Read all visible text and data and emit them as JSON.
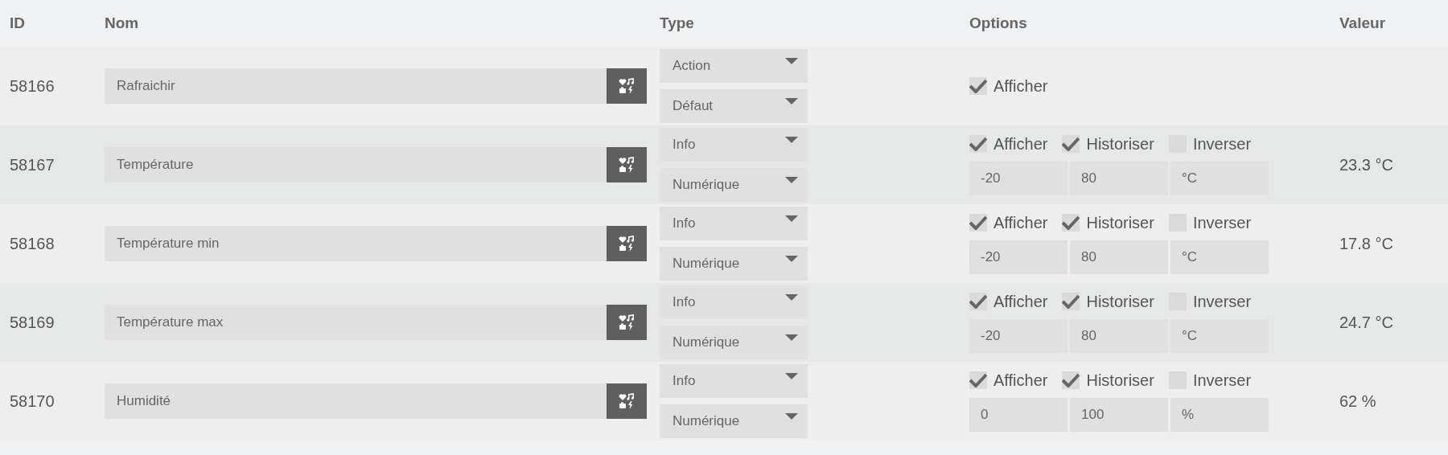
{
  "columns": [
    "ID",
    "Nom",
    "Type",
    "Options",
    "Valeur"
  ],
  "rows": [
    {
      "id": "58166",
      "name": "Rafraichir",
      "type": "Action",
      "subtype": "Défaut",
      "options": [
        {
          "label": "Afficher",
          "checked": true
        }
      ]
    },
    {
      "id": "58167",
      "name": "Température",
      "type": "Info",
      "subtype": "Numérique",
      "options": [
        {
          "label": "Afficher",
          "checked": true
        },
        {
          "label": "Historiser",
          "checked": true
        },
        {
          "label": "Inverser",
          "checked": false
        }
      ],
      "fields": [
        "-20",
        "80",
        "°C"
      ],
      "value": "23.3 °C"
    },
    {
      "id": "58168",
      "name": "Température min",
      "type": "Info",
      "subtype": "Numérique",
      "options": [
        {
          "label": "Afficher",
          "checked": true
        },
        {
          "label": "Historiser",
          "checked": true
        },
        {
          "label": "Inverser",
          "checked": false
        }
      ],
      "fields": [
        "-20",
        "80",
        "°C"
      ],
      "value": "17.8 °C"
    },
    {
      "id": "58169",
      "name": "Température max",
      "type": "Info",
      "subtype": "Numérique",
      "options": [
        {
          "label": "Afficher",
          "checked": true
        },
        {
          "label": "Historiser",
          "checked": true
        },
        {
          "label": "Inverser",
          "checked": false
        }
      ],
      "fields": [
        "-20",
        "80",
        "°C"
      ],
      "value": "24.7 °C"
    },
    {
      "id": "58170",
      "name": "Humidité",
      "type": "Info",
      "subtype": "Numérique",
      "options": [
        {
          "label": "Afficher",
          "checked": true
        },
        {
          "label": "Historiser",
          "checked": true
        },
        {
          "label": "Inverser",
          "checked": false
        }
      ],
      "fields": [
        "0",
        "100",
        "%"
      ],
      "value": "62 %"
    }
  ]
}
